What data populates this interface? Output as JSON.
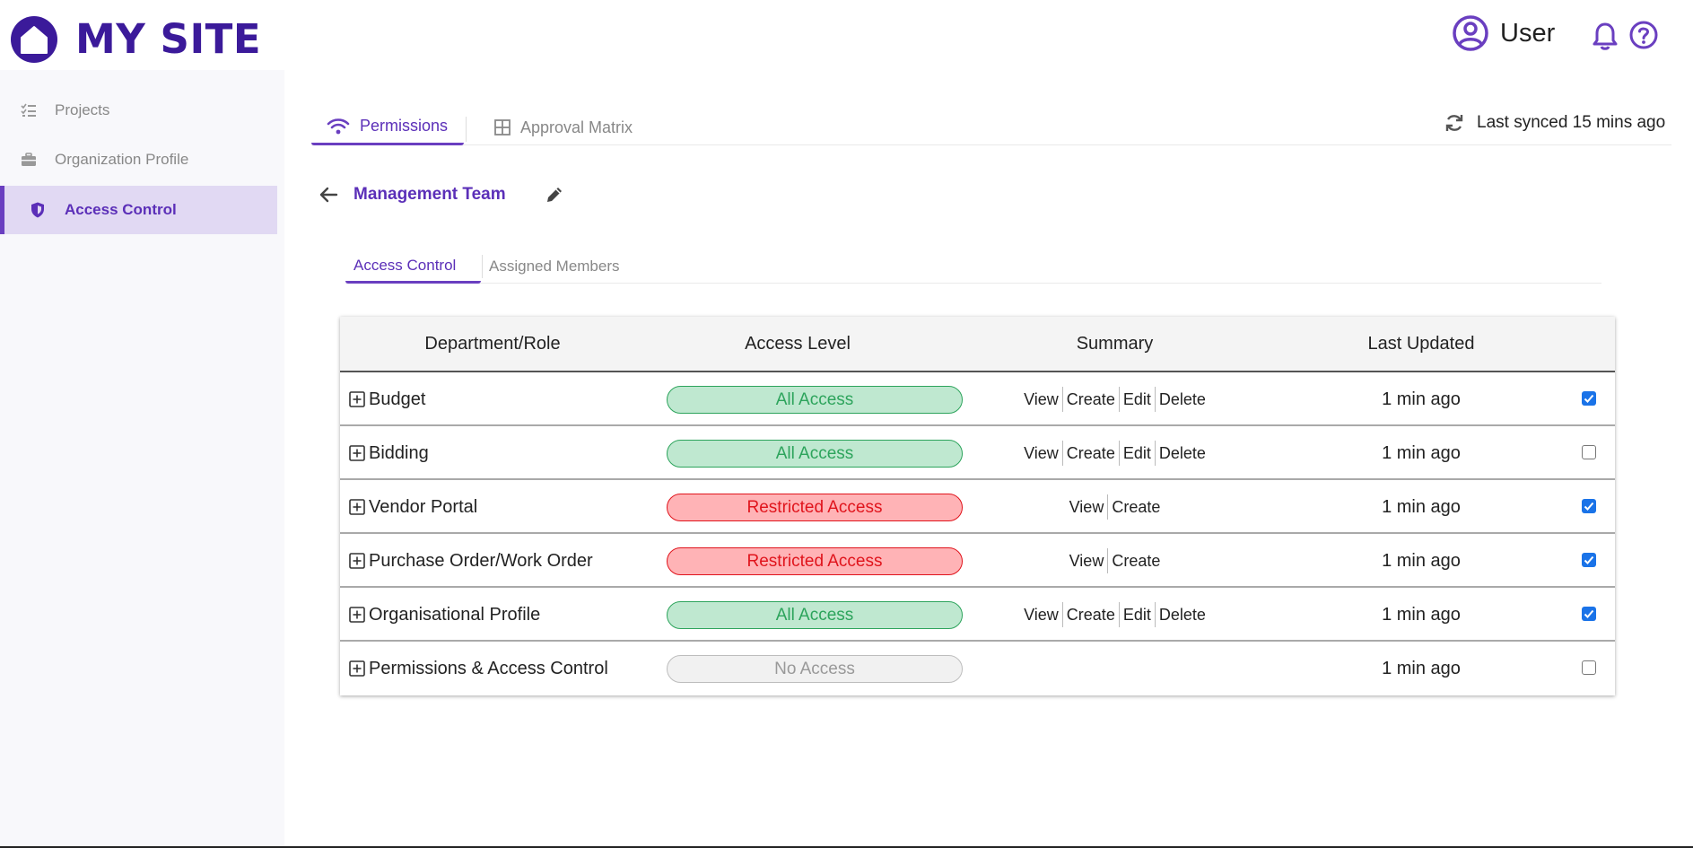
{
  "header": {
    "site_name": "MY SITE",
    "user_name": "User"
  },
  "sidebar": {
    "items": [
      {
        "label": "Projects",
        "icon": "list-check-icon",
        "active": false
      },
      {
        "label": "Organization Profile",
        "icon": "briefcase-icon",
        "active": false
      },
      {
        "label": "Access Control",
        "icon": "shield-icon",
        "active": true
      }
    ]
  },
  "top_tabs": [
    {
      "label": "Permissions",
      "icon": "wifi-icon",
      "active": true
    },
    {
      "label": "Approval Matrix",
      "icon": "grid-icon",
      "active": false
    }
  ],
  "sync_status": "Last synced 15 mins ago",
  "team": {
    "name": "Management Team"
  },
  "sub_tabs": [
    {
      "label": "Access Control",
      "active": true
    },
    {
      "label": "Assigned Members",
      "active": false
    }
  ],
  "table": {
    "columns": [
      "Department/Role",
      "Access Level",
      "Summary",
      "Last Updated"
    ],
    "rows": [
      {
        "name": "Budget",
        "access": "All Access",
        "access_type": "all",
        "summary": [
          "View",
          "Create",
          "Edit",
          "Delete"
        ],
        "updated": "1 min ago",
        "checked": true
      },
      {
        "name": "Bidding",
        "access": "All Access",
        "access_type": "all",
        "summary": [
          "View",
          "Create",
          "Edit",
          "Delete"
        ],
        "updated": "1 min ago",
        "checked": false
      },
      {
        "name": "Vendor Portal",
        "access": "Restricted Access",
        "access_type": "restricted",
        "summary": [
          "View",
          "Create"
        ],
        "updated": "1 min ago",
        "checked": true
      },
      {
        "name": "Purchase Order/Work Order",
        "access": "Restricted Access",
        "access_type": "restricted",
        "summary": [
          "View",
          "Create"
        ],
        "updated": "1 min ago",
        "checked": true
      },
      {
        "name": "Organisational Profile",
        "access": "All Access",
        "access_type": "all",
        "summary": [
          "View",
          "Create",
          "Edit",
          "Delete"
        ],
        "updated": "1 min ago",
        "checked": true
      },
      {
        "name": "Permissions & Access Control",
        "access": "No Access",
        "access_type": "none",
        "summary": [],
        "updated": "1 min ago",
        "checked": false
      }
    ]
  },
  "colors": {
    "brand": "#3b1a9a",
    "accent": "#6a3fc0",
    "all_access": "#2da45c",
    "restricted_access": "#e0141c",
    "no_access": "#999999",
    "checkbox": "#1a73e8"
  }
}
